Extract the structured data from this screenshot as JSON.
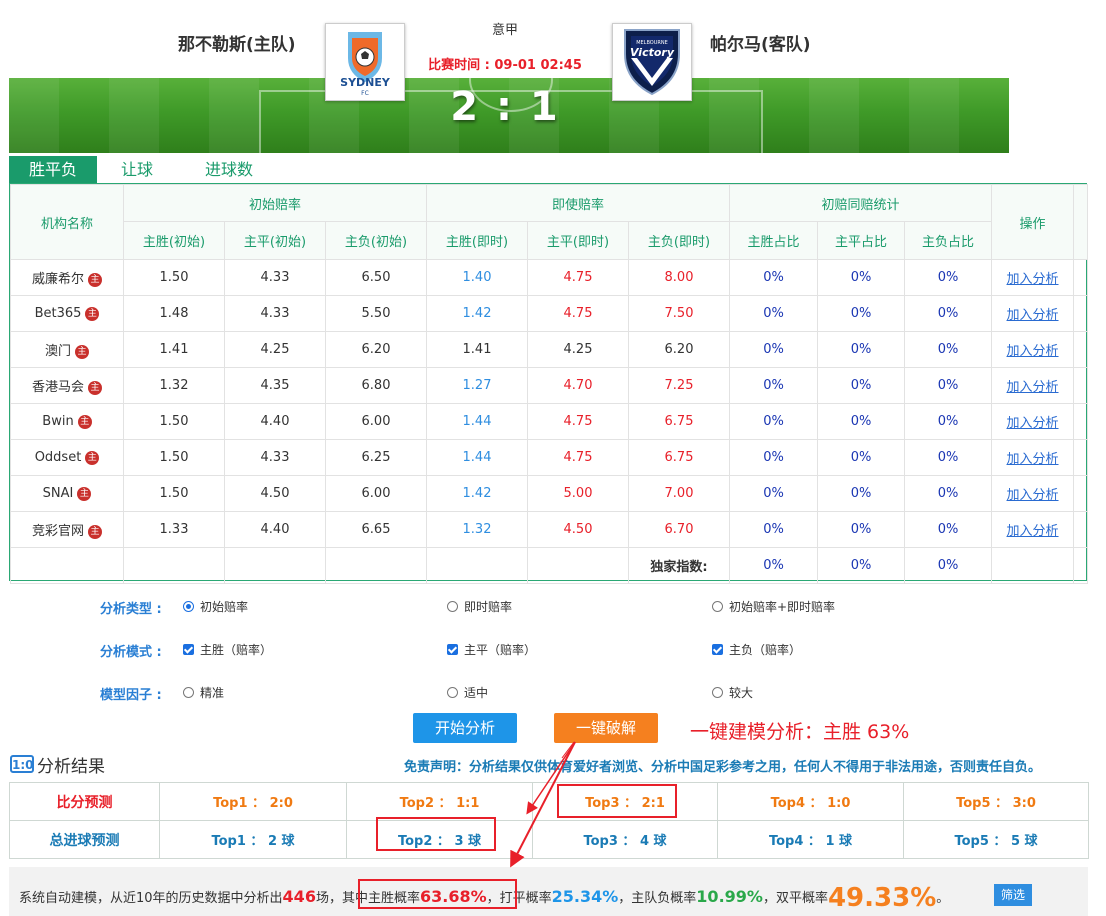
{
  "header": {
    "home_team": "那不勒斯(主队)",
    "away_team": "帕尔马(客队)",
    "league": "意甲",
    "match_time": "比赛时间 : 09-01 02:45",
    "score": "2 : 1",
    "home_logo_text": "SYDNEY",
    "home_logo_sub": "FC",
    "away_logo_text": "Victory",
    "away_logo_sub": "MELBOURNE"
  },
  "tabs": [
    "胜平负",
    "让球",
    "进球数"
  ],
  "odds": {
    "header_agent": "机构名称",
    "group_initial": "初始赔率",
    "group_live": "即使赔率",
    "group_stats": "初赔同赔统计",
    "header_action": "操作",
    "sub_headers": [
      "主胜(初始)",
      "主平(初始)",
      "主负(初始)",
      "主胜(即时)",
      "主平(即时)",
      "主负(即时)",
      "主胜占比",
      "主平占比",
      "主负占比"
    ],
    "rows": [
      {
        "agent": "威廉希尔",
        "i": [
          "1.50",
          "4.33",
          "6.50"
        ],
        "l": [
          "1.40",
          "4.75",
          "8.00"
        ],
        "lc": [
          "blue",
          "red",
          "red"
        ],
        "p": [
          "0%",
          "0%",
          "0%"
        ],
        "action": "加入分析"
      },
      {
        "agent": "Bet365",
        "i": [
          "1.48",
          "4.33",
          "5.50"
        ],
        "l": [
          "1.42",
          "4.75",
          "7.50"
        ],
        "lc": [
          "blue",
          "red",
          "red"
        ],
        "p": [
          "0%",
          "0%",
          "0%"
        ],
        "action": "加入分析"
      },
      {
        "agent": "澳门",
        "i": [
          "1.41",
          "4.25",
          "6.20"
        ],
        "l": [
          "1.41",
          "4.25",
          "6.20"
        ],
        "lc": [
          "",
          "",
          ""
        ],
        "p": [
          "0%",
          "0%",
          "0%"
        ],
        "action": "加入分析"
      },
      {
        "agent": "香港马会",
        "i": [
          "1.32",
          "4.35",
          "6.80"
        ],
        "l": [
          "1.27",
          "4.70",
          "7.25"
        ],
        "lc": [
          "blue",
          "red",
          "red"
        ],
        "p": [
          "0%",
          "0%",
          "0%"
        ],
        "action": "加入分析"
      },
      {
        "agent": "Bwin",
        "i": [
          "1.50",
          "4.40",
          "6.00"
        ],
        "l": [
          "1.44",
          "4.75",
          "6.75"
        ],
        "lc": [
          "blue",
          "red",
          "red"
        ],
        "p": [
          "0%",
          "0%",
          "0%"
        ],
        "action": "加入分析"
      },
      {
        "agent": "Oddset",
        "i": [
          "1.50",
          "4.33",
          "6.25"
        ],
        "l": [
          "1.44",
          "4.75",
          "6.75"
        ],
        "lc": [
          "blue",
          "red",
          "red"
        ],
        "p": [
          "0%",
          "0%",
          "0%"
        ],
        "action": "加入分析"
      },
      {
        "agent": "SNAI",
        "i": [
          "1.50",
          "4.50",
          "6.00"
        ],
        "l": [
          "1.42",
          "5.00",
          "7.00"
        ],
        "lc": [
          "blue",
          "red",
          "red"
        ],
        "p": [
          "0%",
          "0%",
          "0%"
        ],
        "action": "加入分析"
      },
      {
        "agent": "竞彩官网",
        "i": [
          "1.33",
          "4.40",
          "6.65"
        ],
        "l": [
          "1.32",
          "4.50",
          "6.70"
        ],
        "lc": [
          "blue",
          "red",
          "red"
        ],
        "p": [
          "0%",
          "0%",
          "0%"
        ],
        "action": "加入分析"
      }
    ],
    "exclusive_label": "独家指数:",
    "exclusive": [
      "0%",
      "0%",
      "0%"
    ],
    "badge": "主"
  },
  "options": {
    "type_label": "分析类型 :",
    "type_opts": [
      "初始赔率",
      "即时赔率",
      "初始赔率+即时赔率"
    ],
    "mode_label": "分析模式 :",
    "mode_opts": [
      "主胜（赔率）",
      "主平（赔率）",
      "主负（赔率）"
    ],
    "factor_label": "模型因子 :",
    "factor_opts": [
      "精准",
      "适中",
      "较大"
    ]
  },
  "buttons": {
    "start": "开始分析",
    "crack": "一键破解"
  },
  "annotation": "一键建模分析：主胜 63%",
  "results": {
    "icon": "1:0",
    "title": "分析结果",
    "disclaimer": "免责声明：分析结果仅供体育爱好者浏览、分析中国足彩参考之用，任何人不得用于非法用途，否则责任自负。",
    "score_label": "比分预测",
    "scores": [
      "Top1 ： 2:0",
      "Top2 ： 1:1",
      "Top3 ： 2:1",
      "Top4 ： 1:0",
      "Top5 ： 3:0"
    ],
    "goals_label": "总进球预测",
    "goals": [
      "Top1 ： 2 球",
      "Top2 ： 3 球",
      "Top3 ： 4 球",
      "Top4 ： 1 球",
      "Top5 ： 5 球"
    ]
  },
  "summary": {
    "t1": "系统自动建模，从近10年的历史数据中分析出",
    "count": "446",
    "t2": "场，",
    "t3": "其中主胜概率",
    "home_win": "63.68%",
    "t4": "，打平概率",
    "draw": "25.34%",
    "t5": "，主队负概率",
    "away_win": "10.99%",
    "t6": "，双平概率",
    "double": "49.33%",
    "t7": "。",
    "filter_btn": "筛选"
  }
}
